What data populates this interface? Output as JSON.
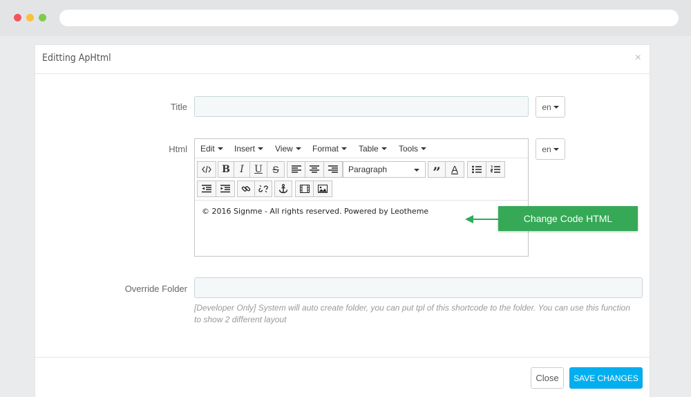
{
  "modal": {
    "title": "Editting ApHtml",
    "close_symbol": "×"
  },
  "form": {
    "title_label": "Title",
    "title_value": "",
    "title_lang": "en",
    "html_label": "Html",
    "html_lang": "en",
    "override_label": "Override Folder",
    "override_value": "",
    "override_help": "[Developer Only] System will auto create folder, you can put tpl of this shortcode to the folder. You can use this function to show 2 different layout"
  },
  "editor": {
    "menus": [
      "Edit",
      "Insert",
      "View",
      "Format",
      "Table",
      "Tools"
    ],
    "format_select": "Paragraph",
    "content": "© 2016 Signme - All rights reserved. Powered by Leotheme",
    "toolbar_icons": [
      "code-icon",
      "bold-icon",
      "italic-icon",
      "underline-icon",
      "strikethrough-icon",
      "align-left-icon",
      "align-center-icon",
      "align-right-icon",
      "blockquote-icon",
      "text-color-icon",
      "bullet-list-icon",
      "numbered-list-icon",
      "outdent-icon",
      "indent-icon",
      "link-icon",
      "unlink-icon",
      "anchor-icon",
      "media-icon",
      "image-icon"
    ]
  },
  "callout": {
    "text": "Change Code HTML",
    "color": "#35a956"
  },
  "footer": {
    "close_label": "Close",
    "save_label": "SAVE CHANGES",
    "save_color": "#00aff0"
  }
}
